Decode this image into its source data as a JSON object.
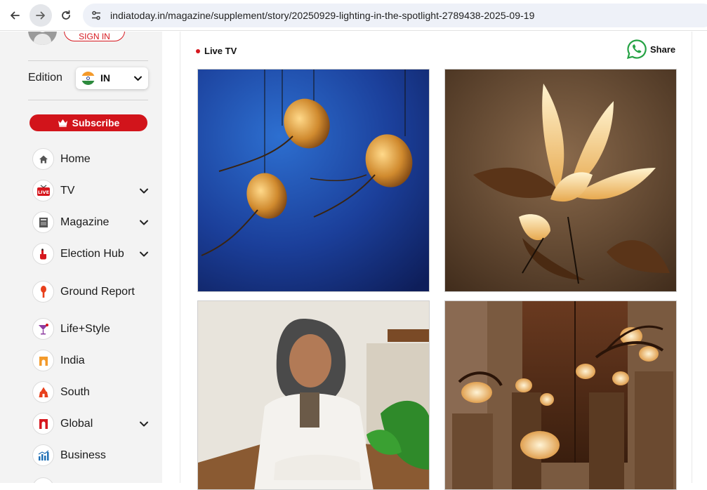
{
  "browser": {
    "url": "indiatoday.in/magazine/supplement/story/20250929-lighting-in-the-spotlight-2789438-2025-09-19"
  },
  "sidebar": {
    "signin_label": "SIGN IN",
    "edition_label": "Edition",
    "edition_value": "IN",
    "subscribe_label": "Subscribe",
    "items": [
      {
        "label": "Home",
        "icon": "home-icon",
        "has_chevron": false
      },
      {
        "label": "TV",
        "icon": "live-tv-icon",
        "has_chevron": true
      },
      {
        "label": "Magazine",
        "icon": "magazine-icon",
        "has_chevron": true
      },
      {
        "label": "Election Hub",
        "icon": "voting-hand-icon",
        "has_chevron": true
      },
      {
        "label": "Ground Report",
        "icon": "microphone-icon",
        "has_chevron": false
      },
      {
        "label": "Life+Style",
        "icon": "cocktail-glass-icon",
        "has_chevron": false
      },
      {
        "label": "India",
        "icon": "india-gate-icon",
        "has_chevron": false
      },
      {
        "label": "South",
        "icon": "temple-icon",
        "has_chevron": false
      },
      {
        "label": "Global",
        "icon": "arch-icon",
        "has_chevron": true
      },
      {
        "label": "Business",
        "icon": "bar-chart-icon",
        "has_chevron": false
      }
    ]
  },
  "content": {
    "live_label": "Live TV",
    "share_label": "Share"
  },
  "colors": {
    "brand_red": "#d2141b",
    "whatsapp_green": "#25a244",
    "sidebar_bg": "#f3f3f3"
  }
}
